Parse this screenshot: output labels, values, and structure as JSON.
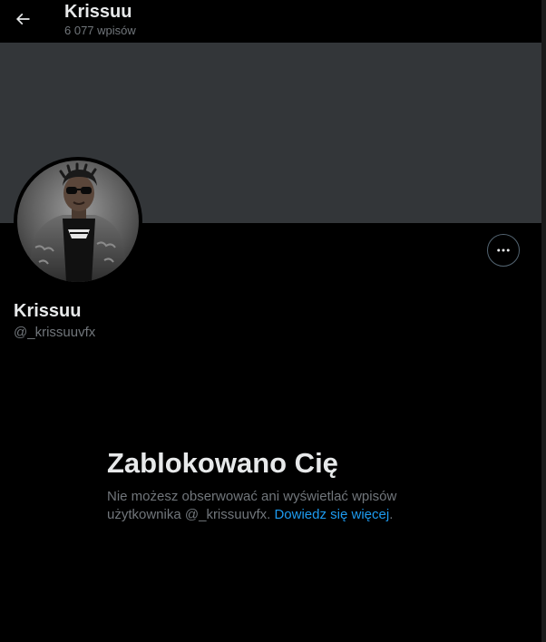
{
  "header": {
    "title": "Krissuu",
    "post_count": "6 077 wpisów",
    "back_icon": "arrow-left-icon"
  },
  "profile": {
    "display_name": "Krissuu",
    "handle": "@_krissuuvfx",
    "more_icon": "more-horizontal-icon",
    "banner_color": "#333639"
  },
  "blocked": {
    "title": "Zablokowano Cię",
    "description": "Nie możesz obserwować ani wyświetlać wpisów użytkownika @_krissuuvfx.",
    "link_text": "Dowiedz się więcej",
    "link_suffix": "."
  },
  "colors": {
    "background": "#000000",
    "text_primary": "#e7e9ea",
    "text_secondary": "#71767b",
    "link": "#1d9bf0",
    "border": "#536471"
  }
}
